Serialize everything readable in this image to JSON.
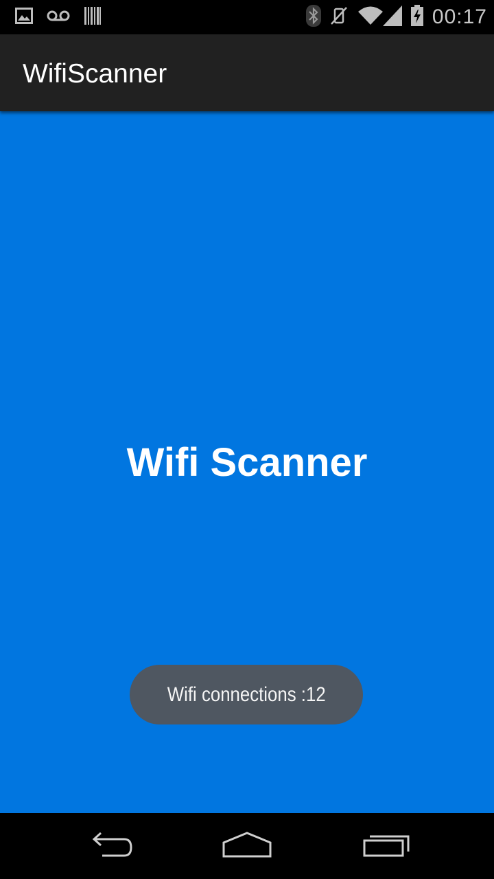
{
  "status_bar": {
    "time": "00:17",
    "left_icons": [
      "image-icon",
      "voicemail-icon",
      "barcode-icon"
    ],
    "right_icons": [
      "bluetooth-icon",
      "vibrate-off-icon",
      "wifi-icon",
      "signal-icon",
      "battery-charging-icon"
    ]
  },
  "app_bar": {
    "title": "WifiScanner"
  },
  "main": {
    "heading": "Wifi Scanner",
    "background_color": "#0176e0"
  },
  "toast": {
    "text": "Wifi connections :12"
  },
  "nav_bar": {
    "buttons": [
      "back-icon",
      "home-icon",
      "recents-icon"
    ]
  }
}
